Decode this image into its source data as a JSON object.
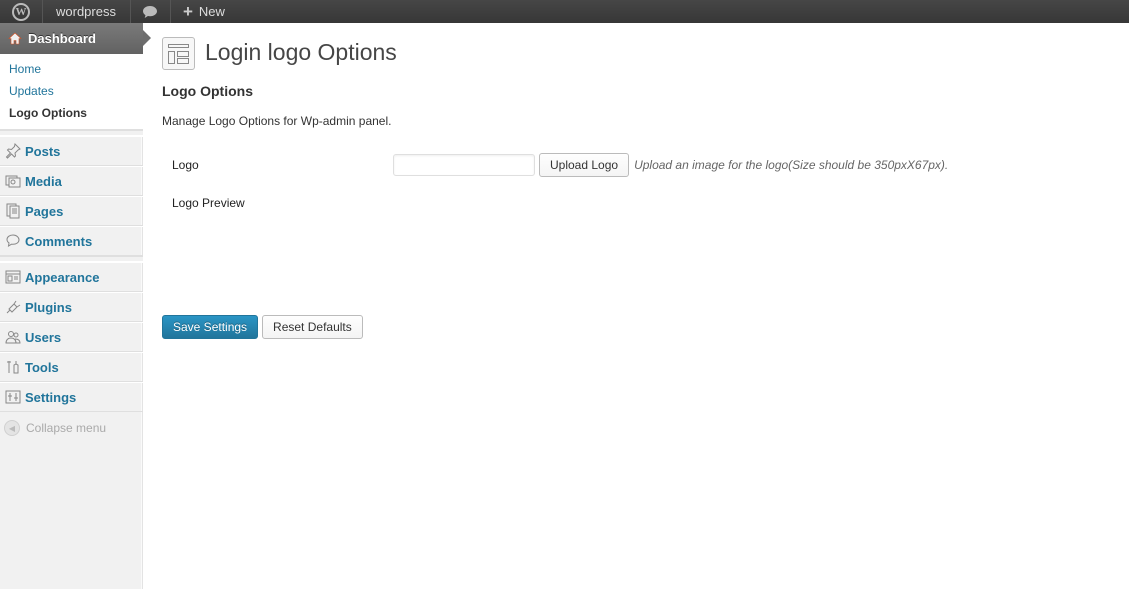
{
  "admin_bar": {
    "logo_icon": "wordpress-logo-icon",
    "site_name": "wordpress",
    "comments_icon": "comment-bubble-icon",
    "new_plus": "+",
    "new_label": "New"
  },
  "sidebar": {
    "dashboard": {
      "label": "Dashboard",
      "icon": "home-icon"
    },
    "submenu": [
      {
        "label": "Home"
      },
      {
        "label": "Updates"
      },
      {
        "label": "Logo Options"
      }
    ],
    "items": [
      {
        "label": "Posts",
        "icon": "pushpin-icon"
      },
      {
        "label": "Media",
        "icon": "media-icon"
      },
      {
        "label": "Pages",
        "icon": "pages-icon"
      },
      {
        "label": "Comments",
        "icon": "comment-icon"
      },
      {
        "label": "Appearance",
        "icon": "appearance-icon"
      },
      {
        "label": "Plugins",
        "icon": "plugin-icon"
      },
      {
        "label": "Users",
        "icon": "users-icon"
      },
      {
        "label": "Tools",
        "icon": "tools-icon"
      },
      {
        "label": "Settings",
        "icon": "settings-icon"
      }
    ],
    "collapse_label": "Collapse menu"
  },
  "main": {
    "page_title": "Login logo Options",
    "section_title": "Logo Options",
    "section_desc": "Manage Logo Options for Wp-admin panel.",
    "logo_field": {
      "label": "Logo",
      "value": "",
      "upload_button": "Upload Logo",
      "hint": "Upload an image for the logo(Size should be 350pxX67px)."
    },
    "preview_label": "Logo Preview",
    "save_button": "Save Settings",
    "reset_button": "Reset Defaults"
  },
  "colors": {
    "link": "#21759b",
    "primary_button": "#21759b",
    "admin_bar": "#464646"
  }
}
